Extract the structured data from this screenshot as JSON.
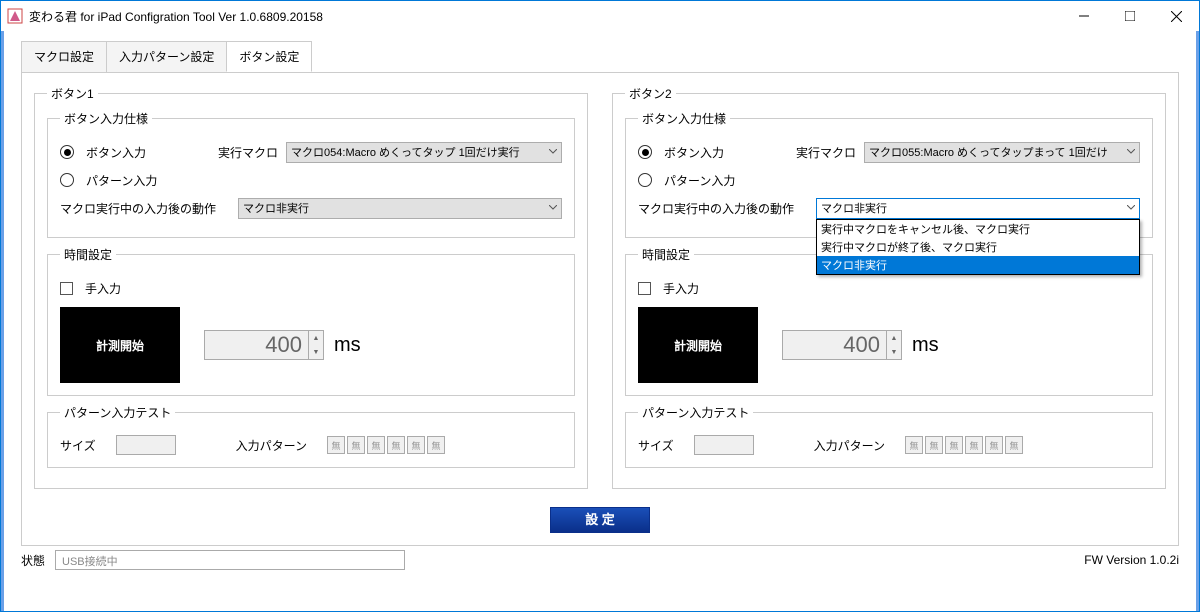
{
  "window": {
    "title": "変わる君 for iPad Configration Tool Ver 1.0.6809.20158"
  },
  "tabs": {
    "t0": "マクロ設定",
    "t1": "入力パターン設定",
    "t2": "ボタン設定"
  },
  "btn1": {
    "legend": "ボタン1",
    "spec_legend": "ボタン入力仕様",
    "radio_button": "ボタン入力",
    "radio_pattern": "パターン入力",
    "macro_label": "実行マクロ",
    "macro_value": "マクロ054:Macro めくってタップ 1回だけ実行",
    "after_label": "マクロ実行中の入力後の動作",
    "after_value": "マクロ非実行",
    "time_legend": "時間設定",
    "manual_label": "手入力",
    "start_label": "計測開始",
    "time_value": "400",
    "ms": "ms",
    "pattern_legend": "パターン入力テスト",
    "size_label": "サイズ",
    "input_label": "入力パターン",
    "pb": "無"
  },
  "btn2": {
    "legend": "ボタン2",
    "spec_legend": "ボタン入力仕様",
    "radio_button": "ボタン入力",
    "radio_pattern": "パターン入力",
    "macro_label": "実行マクロ",
    "macro_value": "マクロ055:Macro めくってタップまって 1回だけ",
    "after_label": "マクロ実行中の入力後の動作",
    "after_value": "マクロ非実行",
    "dropdown": {
      "o0": "実行中マクロをキャンセル後、マクロ実行",
      "o1": "実行中マクロが終了後、マクロ実行",
      "o2": "マクロ非実行"
    },
    "time_legend": "時間設定",
    "manual_label": "手入力",
    "start_label": "計測開始",
    "time_value": "400",
    "ms": "ms",
    "pattern_legend": "パターン入力テスト",
    "size_label": "サイズ",
    "input_label": "入力パターン",
    "pb": "無"
  },
  "set_button": "設 定",
  "status": {
    "label": "状態",
    "value": "USB接続中"
  },
  "fw": "FW Version 1.0.2i"
}
